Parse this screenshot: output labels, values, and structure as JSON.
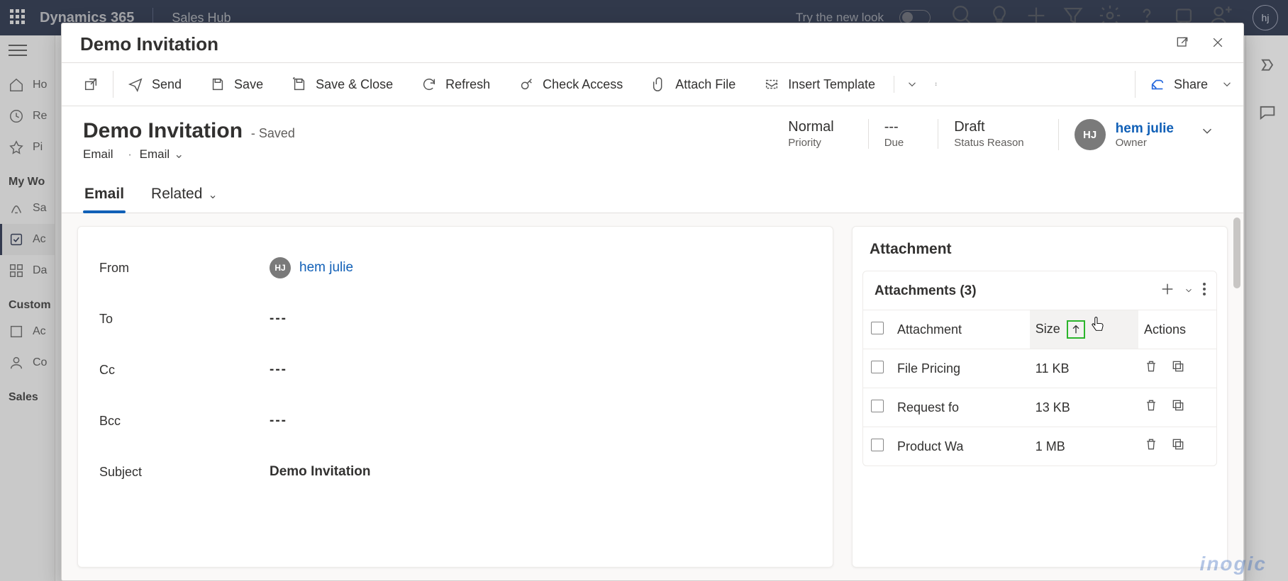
{
  "topbar": {
    "brand": "Dynamics 365",
    "sub": "Sales Hub",
    "try": "Try the new look",
    "avatar": "hj"
  },
  "leftnav": {
    "items": [
      "Ho",
      "Re",
      "Pi"
    ],
    "section1": "My Wo",
    "sec1_items": [
      "Sa",
      "Ac",
      "Da"
    ],
    "section2": "Custom",
    "sec2_items": [
      "Ac",
      "Co"
    ],
    "section3": "Sales"
  },
  "modal": {
    "title": "Demo Invitation",
    "cmd": {
      "send": "Send",
      "save": "Save",
      "saveclose": "Save & Close",
      "refresh": "Refresh",
      "check": "Check Access",
      "attach": "Attach File",
      "insert": "Insert Template",
      "share": "Share"
    },
    "record": {
      "title": "Demo Invitation",
      "saved": "- Saved",
      "entity": "Email",
      "form": "Email",
      "priority_v": "Normal",
      "priority_k": "Priority",
      "due_v": "---",
      "due_k": "Due",
      "status_v": "Draft",
      "status_k": "Status Reason",
      "owner_name": "hem julie",
      "owner_k": "Owner",
      "owner_initials": "HJ"
    },
    "tabs": {
      "email": "Email",
      "related": "Related"
    },
    "form": {
      "from_k": "From",
      "from_v": "hem julie",
      "from_init": "HJ",
      "to_k": "To",
      "to_v": "---",
      "cc_k": "Cc",
      "cc_v": "---",
      "bcc_k": "Bcc",
      "bcc_v": "---",
      "subj_k": "Subject",
      "subj_v": "Demo Invitation"
    },
    "attachments": {
      "panel_title": "Attachment",
      "list_title": "Attachments (3)",
      "cols": {
        "att": "Attachment",
        "size": "Size",
        "actions": "Actions"
      },
      "rows": [
        {
          "name": "File Pricing",
          "size": "11 KB"
        },
        {
          "name": "Request fo",
          "size": "13 KB"
        },
        {
          "name": "Product Wa",
          "size": "1 MB"
        }
      ]
    }
  },
  "watermark": "inogic"
}
